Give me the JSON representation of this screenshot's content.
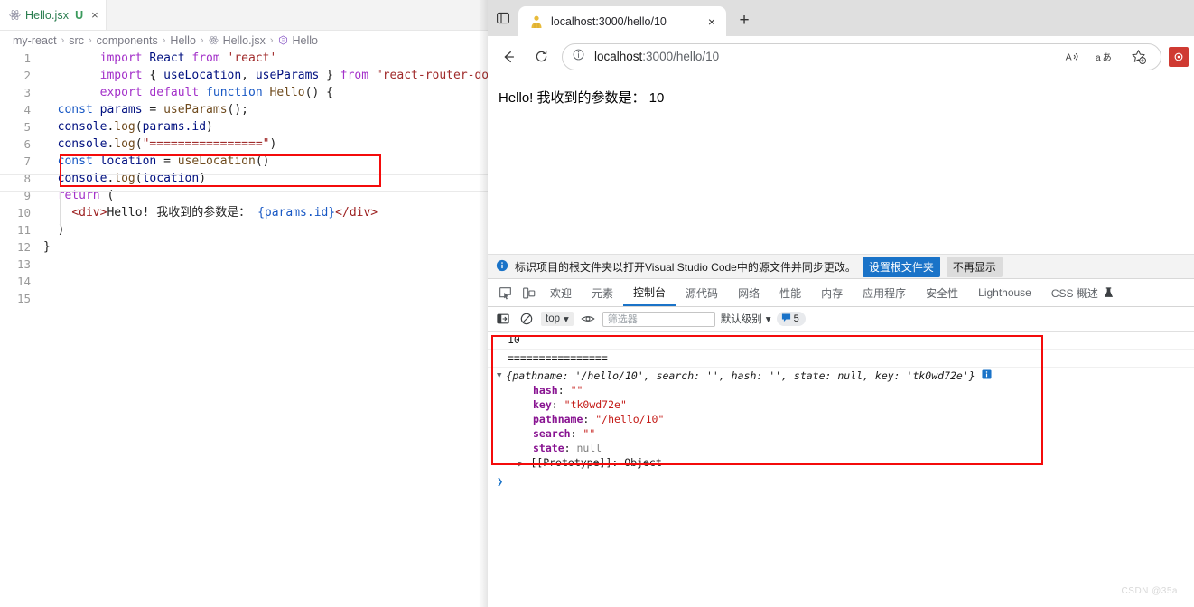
{
  "editor": {
    "tab": {
      "filename": "Hello.jsx",
      "badge": "U",
      "close": "×",
      "icon": "react-icon"
    },
    "breadcrumb": [
      "my-react",
      "src",
      "components",
      "Hello",
      "Hello.jsx",
      "Hello"
    ],
    "breadcrumb_sep": "›",
    "line_numbers": [
      "1",
      "2",
      "3",
      "4",
      "5",
      "6",
      "7",
      "8",
      "9",
      "10",
      "11",
      "12",
      "13",
      "14",
      "15"
    ],
    "code": {
      "l1_import": "import",
      "l1_react": "React",
      "l1_from": "from",
      "l1_mod": "'react'",
      "l2_import": "import",
      "l2_brace_open": "{",
      "l2_useLocation": "useLocation",
      "l2_comma": ",",
      "l2_useParams": "useParams",
      "l2_brace_close": "}",
      "l2_from": "from",
      "l2_mod": "\"react-router-dom\";",
      "l3_export": "export",
      "l3_default": "default",
      "l3_function": "function",
      "l3_name": "Hello",
      "l3_parens": "()",
      "l3_brace": "{",
      "l4_const": "const",
      "l4_var": "params",
      "l4_eq": "=",
      "l4_call": "useParams",
      "l4_tail": "();",
      "l5_console": "console",
      "l5_dot": ".",
      "l5_log": "log",
      "l5_open": "(",
      "l5_arg": "params.id",
      "l5_close": ")",
      "l6_console": "console",
      "l6_dot": ".",
      "l6_log": "log",
      "l6_open": "(",
      "l6_str": "\"================\"",
      "l6_close": ")",
      "l7_const": "const",
      "l7_var": "location",
      "l7_eq": "=",
      "l7_call": "useLocation",
      "l7_tail": "()",
      "l8_console": "console",
      "l8_dot": ".",
      "l8_log": "log",
      "l8_open": "(",
      "l8_arg": "location",
      "l8_close": ")",
      "l9_return": "return",
      "l9_paren": "(",
      "l10_divopen": "<div>",
      "l10_text": "Hello! 我收到的参数是： ",
      "l10_expr": "{params.id}",
      "l10_divclose": "</div>",
      "l11_paren": ")",
      "l12_brace": "}"
    }
  },
  "browser": {
    "tab": {
      "title": "localhost:3000/hello/10",
      "close": "×",
      "favicon": "lock-person-icon"
    },
    "newtab": "+",
    "nav": {
      "back": "←",
      "reload": "⟳"
    },
    "omnibox": {
      "info_icon": "info-circle-icon",
      "url_host": "localhost",
      "url_rest": ":3000/hello/10",
      "read_aloud": "A",
      "translate": "aあ",
      "favorite": "☆"
    },
    "page": {
      "text": "Hello! 我收到的参数是：  10"
    },
    "infobar": {
      "icon": "info-icon",
      "message": "标识项目的根文件夹以打开Visual Studio Code中的源文件并同步更改。",
      "primary_button": "设置根文件夹",
      "secondary_button": "不再显示"
    }
  },
  "devtools": {
    "tabs": [
      {
        "label": "欢迎",
        "active": false
      },
      {
        "label": "元素",
        "active": false
      },
      {
        "label": "控制台",
        "active": true
      },
      {
        "label": "源代码",
        "active": false
      },
      {
        "label": "网络",
        "active": false
      },
      {
        "label": "性能",
        "active": false
      },
      {
        "label": "内存",
        "active": false
      },
      {
        "label": "应用程序",
        "active": false
      },
      {
        "label": "安全性",
        "active": false
      },
      {
        "label": "Lighthouse",
        "active": false
      },
      {
        "label": "CSS 概述",
        "active": false
      }
    ],
    "toolbar": {
      "sidebar_icon": "console-sidebar-icon",
      "clear_icon": "clear-console-icon",
      "context": "top",
      "context_caret": "▾",
      "eye_icon": "live-expression-icon",
      "filter_placeholder": "筛选器",
      "level": "默认级别",
      "level_caret": "▾",
      "info_badge_count": "5",
      "info_badge_icon": "info-bubble-icon"
    },
    "console": {
      "rows": [
        {
          "type": "log",
          "text": "10"
        },
        {
          "type": "log",
          "text": "================"
        }
      ],
      "object": {
        "triangle": "▼",
        "summary": "{pathname: '/hello/10', search: '', hash: '', state: null, key: 'tk0wd72e'}",
        "info_icon": "info-badge-icon",
        "props": [
          {
            "name": "hash",
            "value": "\"\"",
            "kind": "string"
          },
          {
            "name": "key",
            "value": "\"tk0wd72e\"",
            "kind": "string"
          },
          {
            "name": "pathname",
            "value": "\"/hello/10\"",
            "kind": "string"
          },
          {
            "name": "search",
            "value": "\"\"",
            "kind": "string"
          },
          {
            "name": "state",
            "value": "null",
            "kind": "null"
          }
        ],
        "prototype_triangle": "▶",
        "prototype_label": "[[Prototype]]: Object"
      },
      "prompt": "❯"
    }
  },
  "annotations": {
    "color": "#f40b0b"
  },
  "watermark": "CSDN @35a"
}
